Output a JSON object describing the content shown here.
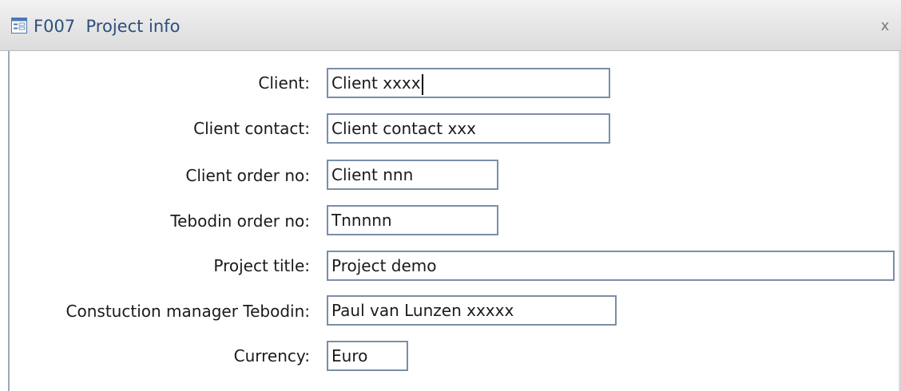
{
  "window": {
    "title": "F007  Project info",
    "close_label": "x",
    "form_icon": "form-icon"
  },
  "fields": [
    {
      "label": "Client:",
      "value": "Client xxxx",
      "focused": true
    },
    {
      "label": "Client contact:",
      "value": "Client contact xxx"
    },
    {
      "label": "Client order no:",
      "value": "Client nnn"
    },
    {
      "label": "Tebodin order no:",
      "value": "Tnnnnn"
    },
    {
      "label": "Project title:",
      "value": "Project demo"
    },
    {
      "label": "Constuction manager Tebodin:",
      "value": "Paul van Lunzen  xxxxx"
    },
    {
      "label": "Currency:",
      "value": "Euro"
    }
  ]
}
